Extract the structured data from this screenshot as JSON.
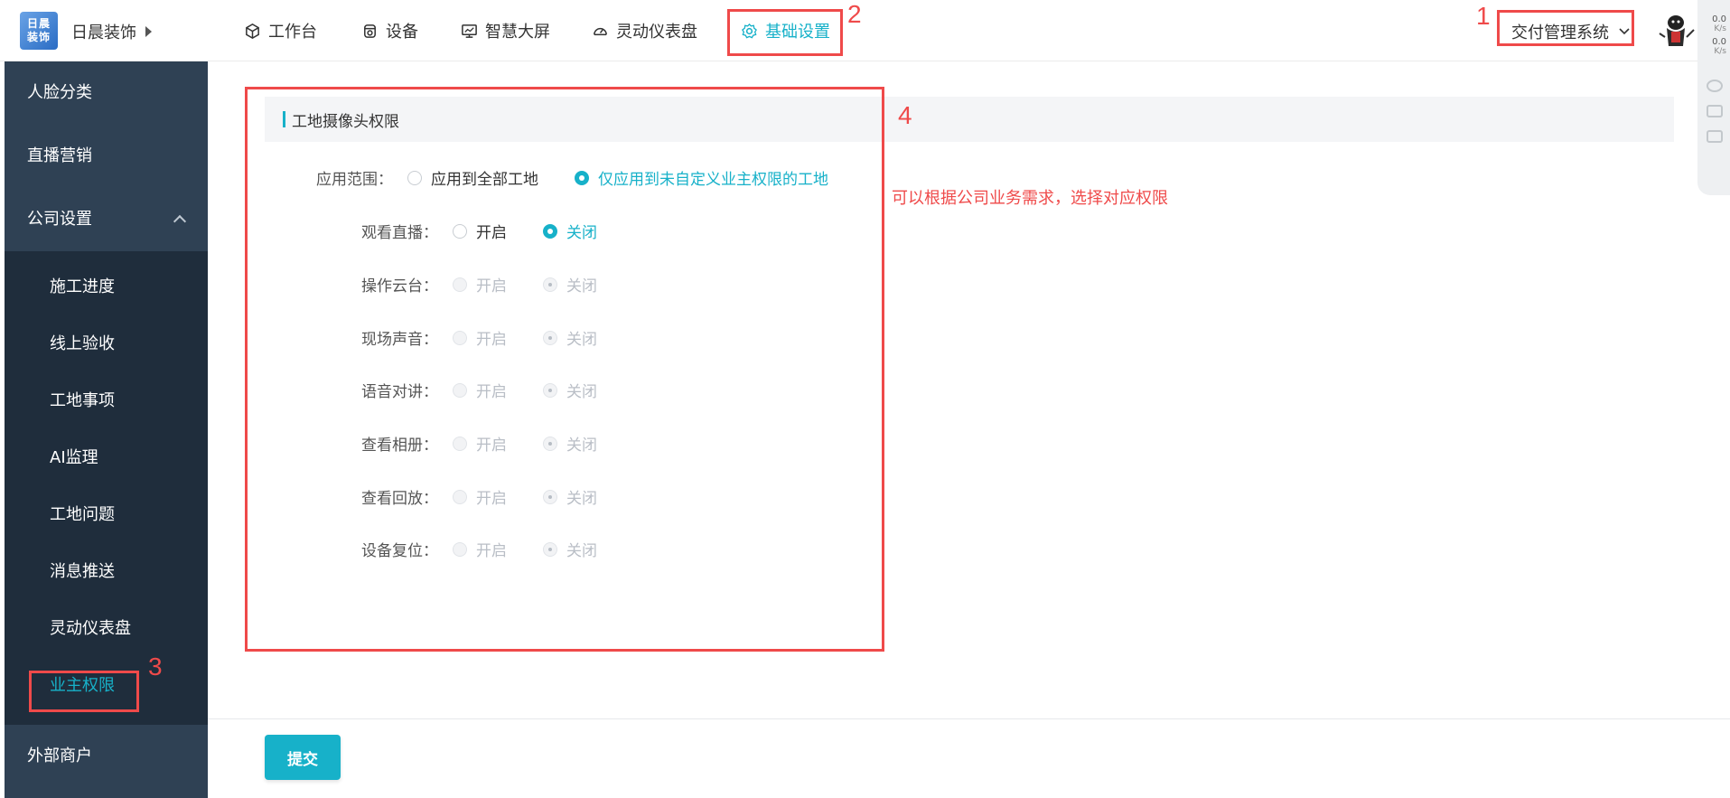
{
  "topbar": {
    "logo_text": "日晨 装饰",
    "brand": "日晨装饰",
    "nav": [
      {
        "label": "工作台",
        "icon": "cube-icon"
      },
      {
        "label": "设备",
        "icon": "device-icon"
      },
      {
        "label": "智慧大屏",
        "icon": "monitor-icon"
      },
      {
        "label": "灵动仪表盘",
        "icon": "dashboard-icon"
      },
      {
        "label": "基础设置",
        "icon": "gear-icon",
        "active": true
      }
    ],
    "system_select": "交付管理系统"
  },
  "float_tool": {
    "up_speed": "0.0",
    "up_unit": "K/s",
    "down_speed": "0.0",
    "down_unit": "K/s"
  },
  "sidebar": {
    "top_items": [
      "人脸分类",
      "直播营销"
    ],
    "group": {
      "label": "公司设置",
      "expanded": true
    },
    "sub_items": [
      "施工进度",
      "线上验收",
      "工地事项",
      "AI监理",
      "工地问题",
      "消息推送",
      "灵动仪表盘",
      "业主权限"
    ],
    "active_sub": "业主权限",
    "bottom_items": [
      "外部商户"
    ]
  },
  "section": {
    "title": "工地摄像头权限"
  },
  "scope": {
    "label": "应用范围：",
    "options": [
      "应用到全部工地",
      "仅应用到未自定义业主权限的工地"
    ],
    "selected": 1
  },
  "permissions": [
    {
      "label": "观看直播：",
      "on": "开启",
      "off": "关闭",
      "value": "off",
      "disabled": false
    },
    {
      "label": "操作云台：",
      "on": "开启",
      "off": "关闭",
      "value": "off",
      "disabled": true
    },
    {
      "label": "现场声音：",
      "on": "开启",
      "off": "关闭",
      "value": "off",
      "disabled": true
    },
    {
      "label": "语音对讲：",
      "on": "开启",
      "off": "关闭",
      "value": "off",
      "disabled": true
    },
    {
      "label": "查看相册：",
      "on": "开启",
      "off": "关闭",
      "value": "off",
      "disabled": true
    },
    {
      "label": "查看回放：",
      "on": "开启",
      "off": "关闭",
      "value": "off",
      "disabled": true
    },
    {
      "label": "设备复位：",
      "on": "开启",
      "off": "关闭",
      "value": "off",
      "disabled": true
    }
  ],
  "hint": "可以根据公司业务需求，选择对应权限",
  "submit_label": "提交",
  "annotations": [
    "1",
    "2",
    "3",
    "4"
  ],
  "colors": {
    "accent": "#17b1c9",
    "annotation": "#ef4a4a",
    "sidebar": "#2f4154",
    "sidebar_sub": "#1f2d3c"
  }
}
